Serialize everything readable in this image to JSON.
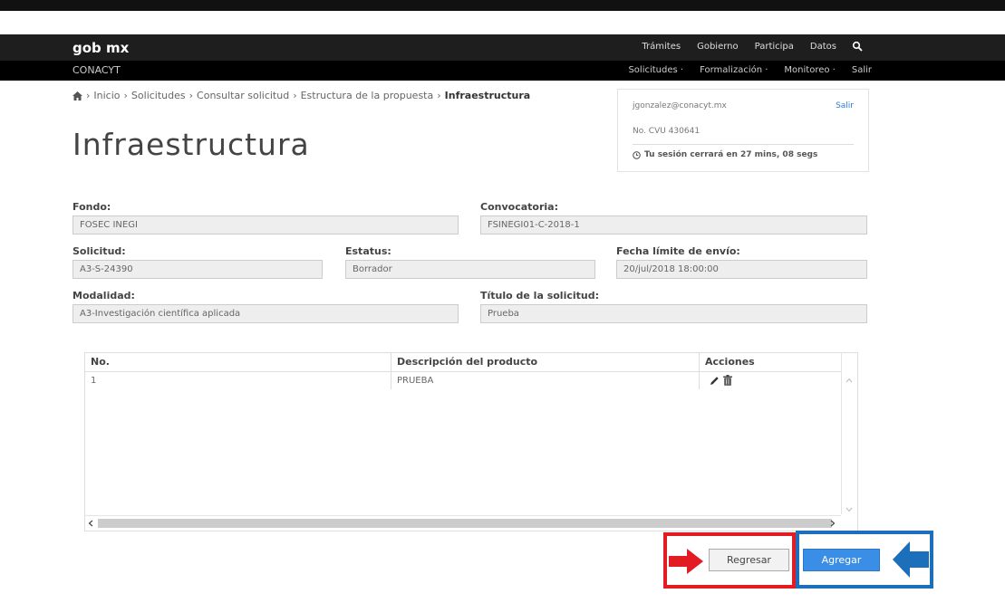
{
  "header": {
    "logo": "gob mx",
    "nav": [
      "Trámites",
      "Gobierno",
      "Participa",
      "Datos"
    ]
  },
  "subheader": {
    "brand": "CONACYT",
    "menu": [
      "Solicitudes ·",
      "Formalización ·",
      "Monitoreo ·",
      "Salir"
    ]
  },
  "breadcrumb": {
    "items": [
      "Inicio",
      "Solicitudes",
      "Consultar solicitud",
      "Estructura de la propuesta"
    ],
    "current": "Infraestructura"
  },
  "page_title": "Infraestructura",
  "session": {
    "email": "jgonzalez@conacyt.mx",
    "logout": "Salir",
    "cvu": "No. CVU 430641",
    "timer": "Tu sesión cerrará en 27 mins, 08 segs"
  },
  "form": {
    "fondo_label": "Fondo:",
    "fondo_value": "FOSEC INEGI",
    "convocatoria_label": "Convocatoria:",
    "convocatoria_value": "FSINEGI01-C-2018-1",
    "solicitud_label": "Solicitud:",
    "solicitud_value": "A3-S-24390",
    "estatus_label": "Estatus:",
    "estatus_value": "Borrador",
    "fecha_label": "Fecha límite de envío:",
    "fecha_value": "20/jul/2018 18:00:00",
    "modalidad_label": "Modalidad:",
    "modalidad_value": "A3-Investigación científica aplicada",
    "titulo_label": "Título de la solicitud:",
    "titulo_value": "Prueba"
  },
  "table": {
    "columns": [
      "No.",
      "Descripción del producto",
      "Acciones"
    ],
    "rows": [
      {
        "no": "1",
        "descripcion": "PRUEBA"
      }
    ]
  },
  "buttons": {
    "back": "Regresar",
    "add": "Agregar"
  },
  "colors": {
    "highlight_red": "#e31b23",
    "highlight_blue": "#1b6fbb",
    "primary_button": "#3a8ee6"
  }
}
